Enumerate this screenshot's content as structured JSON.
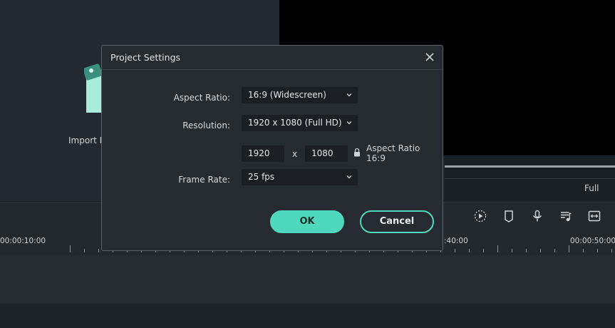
{
  "app": {
    "media_panel": {
      "import_label": "Import M"
    },
    "preview": {
      "zoom_label": "Full"
    },
    "toolbar": {
      "icons": [
        "render-preview-icon",
        "marker-icon",
        "microphone-icon",
        "audio-mix-icon",
        "fit-timeline-icon"
      ]
    },
    "timeline": {
      "timecodes": [
        "00:00:10:00",
        ":40:00",
        "00:00:50:00"
      ]
    }
  },
  "dialog": {
    "title": "Project Settings",
    "aspect_ratio": {
      "label": "Aspect Ratio:",
      "value": "16:9 (Widescreen)"
    },
    "resolution": {
      "label": "Resolution:",
      "value": "1920 x 1080 (Full HD)",
      "width": "1920",
      "separator": "x",
      "height": "1080",
      "note_line1": "Aspect Ratio",
      "note_line2": "16:9"
    },
    "frame_rate": {
      "label": "Frame Rate:",
      "value": "25 fps"
    },
    "ok_label": "OK",
    "cancel_label": "Cancel"
  },
  "colors": {
    "accent": "#4fd8bd",
    "dialog_bg": "#262b32",
    "field_bg": "#1b1f25"
  }
}
